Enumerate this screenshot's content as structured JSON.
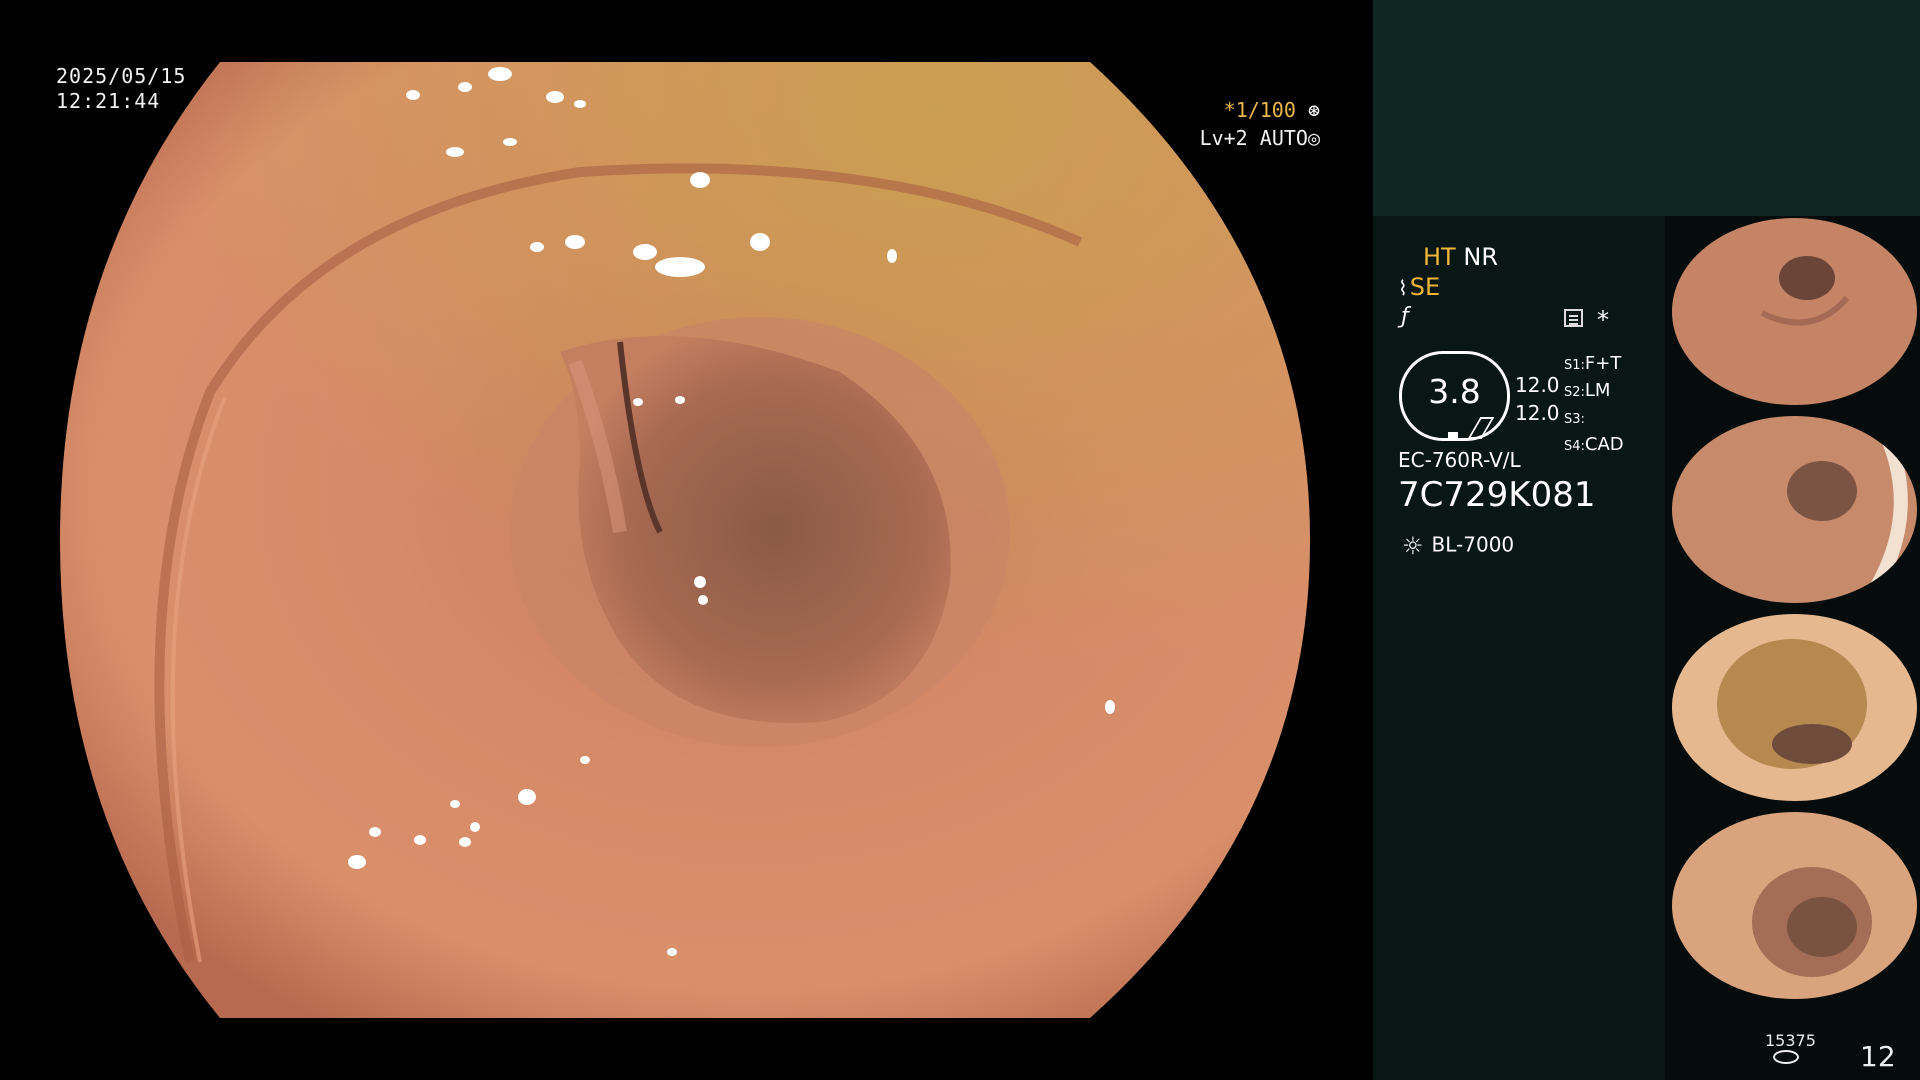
{
  "overlay": {
    "date": "2025/05/15",
    "time": "12:21:44",
    "shutter_star": "*",
    "shutter": "1/100",
    "level": "Lv+2",
    "auto": "AUTO"
  },
  "panel": {
    "ht": "HT",
    "nr": "NR",
    "se": "SE",
    "asterisk": "*",
    "dial_value": "3.8",
    "val1": "12.0",
    "val2": "12.0",
    "s1_key": "S1:",
    "s1_val": "F+T",
    "s2_key": "S2:",
    "s2_val": "LM",
    "s3_key": "S3:",
    "s3_val": "",
    "s4_key": "S4:",
    "s4_val": "CAD",
    "scope_model": "EC-760R-V/L",
    "scope_serial": "7C729K081",
    "light_source": "BL-7000"
  },
  "thumbnails": [
    {
      "label": "captured-image-1"
    },
    {
      "label": "captured-image-2"
    },
    {
      "label": "captured-image-3"
    },
    {
      "label": "captured-image-4"
    }
  ],
  "footer": {
    "capture_count": "15375",
    "image_number": "12"
  },
  "icons": [
    "shutter-mode-icon",
    "auto-mode-icon",
    "structure-enhance-icon",
    "filter-icon",
    "record-icon",
    "light-source-icon",
    "storage-icon"
  ]
}
